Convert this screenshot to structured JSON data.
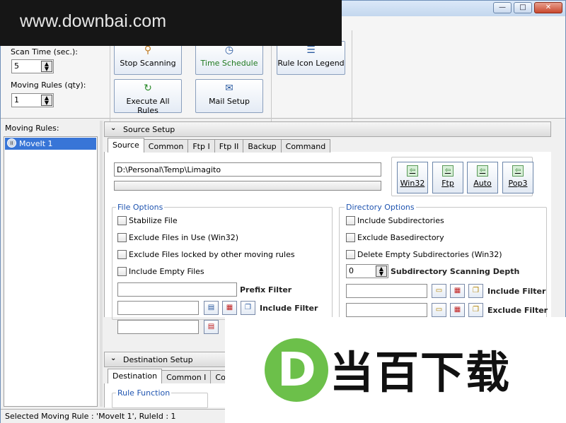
{
  "window": {
    "minimize_glyph": "—",
    "maximize_glyph": "□",
    "close_glyph": "✕"
  },
  "watermark": {
    "text": "www.downbai.com"
  },
  "toolbar": {
    "scan_time_label": "Scan Time (sec.):",
    "scan_time_value": "5",
    "moving_rules_label": "Moving Rules (qty):",
    "moving_rules_value": "1",
    "stop_scanning": "Stop Scanning",
    "execute_all_rules": "Execute All Rules",
    "time_schedule": "Time Schedule",
    "mail_setup": "Mail Setup",
    "rule_icon_legend": "Rule Icon Legend"
  },
  "left": {
    "header": "Moving Rules:",
    "items": [
      {
        "label": "MoveIt 1"
      }
    ]
  },
  "source_setup": {
    "title": "Source Setup",
    "tabs": [
      "Source",
      "Common",
      "Ftp I",
      "Ftp II",
      "Backup",
      "Command"
    ],
    "path": "D:\\Personal\\Temp\\Limagito",
    "buttons": [
      "Win32",
      "Ftp",
      "Auto",
      "Pop3"
    ],
    "file_options": {
      "title": "File Options",
      "checks": [
        "Stabilize File",
        "Exclude Files in Use (Win32)",
        "Exclude Files locked by other moving rules",
        "Include Empty Files"
      ],
      "prefix_filter": "Prefix Filter",
      "include_filter": "Include Filter"
    },
    "directory_options": {
      "title": "Directory Options",
      "checks": [
        "Include Subdirectories",
        "Exclude Basedirectory",
        "Delete Empty Subdirectories (Win32)"
      ],
      "depth_value": "0",
      "depth_label": "Subdirectory Scanning Depth",
      "include_filter": "Include Filter",
      "exclude_filter": "Exclude Filter"
    }
  },
  "destination_setup": {
    "title": "Destination Setup",
    "tabs": [
      "Destination",
      "Common I",
      "Comm"
    ],
    "rule_function": "Rule Function"
  },
  "status": {
    "text": "Selected Moving Rule : 'MoveIt 1', RuleId : 1"
  },
  "logo": {
    "letter": "D",
    "text": "当百下载"
  }
}
